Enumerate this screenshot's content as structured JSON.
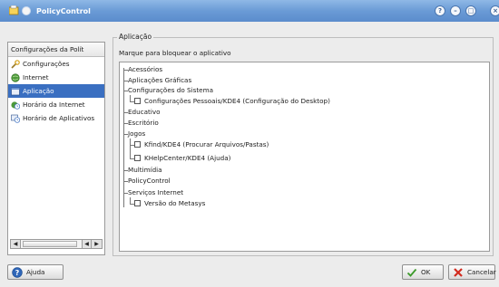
{
  "window": {
    "title": "PolicyControl"
  },
  "sidebar": {
    "header": "Configurações da Polít",
    "items": [
      {
        "label": "Configurações",
        "icon": "wrench-icon"
      },
      {
        "label": "Internet",
        "icon": "globe-icon"
      },
      {
        "label": "Aplicação",
        "icon": "application-icon",
        "selected": true
      },
      {
        "label": "Horário da Internet",
        "icon": "internet-clock-icon"
      },
      {
        "label": "Horário de Aplicativos",
        "icon": "application-clock-icon"
      }
    ]
  },
  "main": {
    "group_title": "Aplicação",
    "description": "Marque para bloquear o aplicativo",
    "tree": {
      "acessorios": "Acessórios",
      "aplicacoes_graficas": "Aplicações Gráficas",
      "configuracoes_sistema": "Configurações do Sistema",
      "config_pessoais": "Configurações Pessoais/KDE4 (Configuração do Desktop)",
      "educativo": "Educativo",
      "escritorio": "Escritório",
      "jogos": "Jogos",
      "kfind": "Kfind/KDE4 (Procurar Arquivos/Pastas)",
      "khelpcenter": "KHelpCenter/KDE4 (Ajuda)",
      "multimidia": "Multimídia",
      "policycontrol": "PolicyControl",
      "servicos_internet": "Serviços Internet",
      "versao_metasys": "Versão do Metasys"
    }
  },
  "footer": {
    "help_label": "Ajuda",
    "ok_label": "OK",
    "cancel_label": "Cancelar"
  },
  "colors": {
    "titlebar": "#6a9bd6",
    "selection": "#3a6fc1"
  }
}
